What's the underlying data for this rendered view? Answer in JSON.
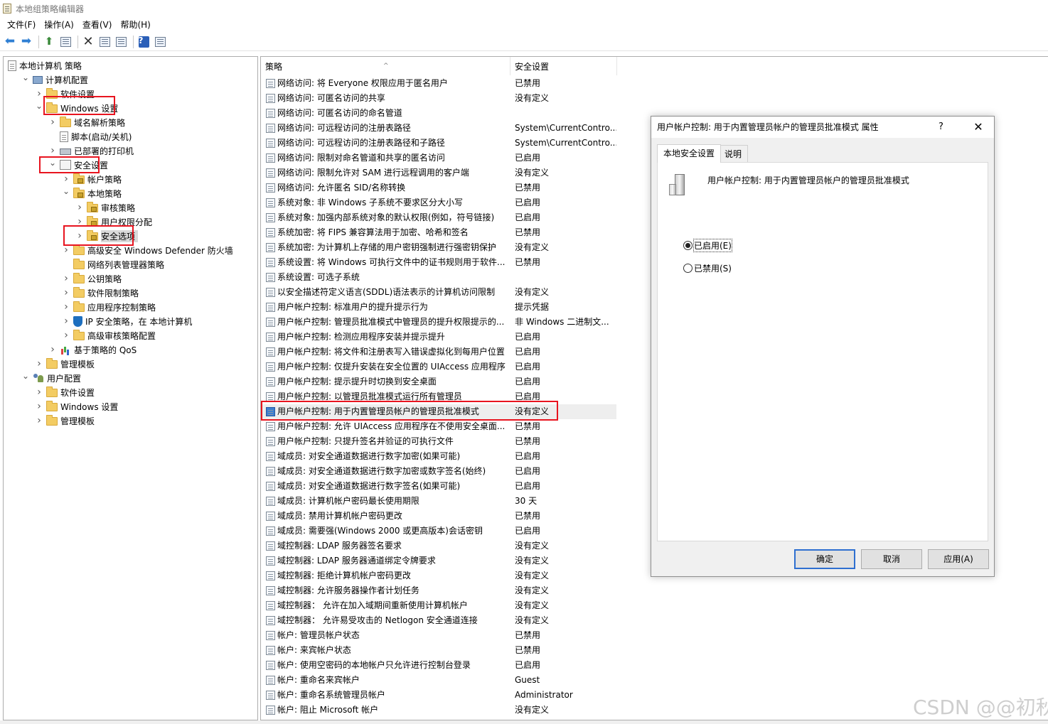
{
  "window": {
    "title": "本地组策略编辑器"
  },
  "menu": [
    "文件(F)",
    "操作(A)",
    "查看(V)",
    "帮助(H)"
  ],
  "toolbar_icons": [
    "back-arrow-icon",
    "forward-arrow-icon",
    "up-folder-icon",
    "show-hide-tree-icon",
    "delete-icon",
    "properties-icon",
    "export-list-icon",
    "help-icon",
    "view-icon"
  ],
  "tree": [
    {
      "label": "本地计算机 策略",
      "level": 0,
      "icon": "policy-doc-icon",
      "expander": ""
    },
    {
      "label": "计算机配置",
      "level": 1,
      "icon": "computer-icon",
      "expander": "open"
    },
    {
      "label": "软件设置",
      "level": 2,
      "icon": "folder-icon",
      "expander": "closed"
    },
    {
      "label": "Windows 设置",
      "level": 2,
      "icon": "folder-icon",
      "expander": "open"
    },
    {
      "label": "域名解析策略",
      "level": 3,
      "icon": "folder-icon",
      "expander": "closed"
    },
    {
      "label": "脚本(启动/关机)",
      "level": 3,
      "icon": "script-doc-icon",
      "expander": ""
    },
    {
      "label": "已部署的打印机",
      "level": 3,
      "icon": "printer-icon",
      "expander": "closed"
    },
    {
      "label": "安全设置",
      "level": 3,
      "icon": "security-settings-icon",
      "expander": "open"
    },
    {
      "label": "帐户策略",
      "level": 4,
      "icon": "lock-folder-icon",
      "expander": "closed"
    },
    {
      "label": "本地策略",
      "level": 4,
      "icon": "lock-folder-icon",
      "expander": "open"
    },
    {
      "label": "审核策略",
      "level": 5,
      "icon": "lock-folder-icon",
      "expander": "closed"
    },
    {
      "label": "用户权限分配",
      "level": 5,
      "icon": "lock-folder-icon",
      "expander": "closed"
    },
    {
      "label": "安全选项",
      "level": 5,
      "icon": "lock-folder-icon",
      "expander": "closed",
      "selected": true
    },
    {
      "label": "高级安全 Windows Defender 防火墙",
      "level": 4,
      "icon": "folder-icon",
      "expander": "closed"
    },
    {
      "label": "网络列表管理器策略",
      "level": 4,
      "icon": "folder-icon",
      "expander": ""
    },
    {
      "label": "公钥策略",
      "level": 4,
      "icon": "folder-icon",
      "expander": "closed"
    },
    {
      "label": "软件限制策略",
      "level": 4,
      "icon": "folder-icon",
      "expander": "closed"
    },
    {
      "label": "应用程序控制策略",
      "level": 4,
      "icon": "folder-icon",
      "expander": "closed"
    },
    {
      "label": "IP 安全策略，在 本地计算机",
      "level": 4,
      "icon": "ip-security-shield-icon",
      "expander": "closed"
    },
    {
      "label": "高级审核策略配置",
      "level": 4,
      "icon": "folder-icon",
      "expander": "closed"
    },
    {
      "label": "基于策略的 QoS",
      "level": 3,
      "icon": "qos-chart-icon",
      "expander": "closed"
    },
    {
      "label": "管理模板",
      "level": 2,
      "icon": "folder-icon",
      "expander": "closed"
    },
    {
      "label": "用户配置",
      "level": 1,
      "icon": "users-icon",
      "expander": "open"
    },
    {
      "label": "软件设置",
      "level": 2,
      "icon": "folder-icon",
      "expander": "closed"
    },
    {
      "label": "Windows 设置",
      "level": 2,
      "icon": "folder-icon",
      "expander": "closed"
    },
    {
      "label": "管理模板",
      "level": 2,
      "icon": "folder-icon",
      "expander": "closed"
    }
  ],
  "list": {
    "columns": [
      "策略",
      "安全设置"
    ],
    "rows": [
      {
        "name": "网络访问: 将 Everyone 权限应用于匿名用户",
        "value": "已禁用"
      },
      {
        "name": "网络访问: 可匿名访问的共享",
        "value": "没有定义"
      },
      {
        "name": "网络访问: 可匿名访问的命名管道",
        "value": ""
      },
      {
        "name": "网络访问: 可远程访问的注册表路径",
        "value": "System\\CurrentContro..."
      },
      {
        "name": "网络访问: 可远程访问的注册表路径和子路径",
        "value": "System\\CurrentContro..."
      },
      {
        "name": "网络访问: 限制对命名管道和共享的匿名访问",
        "value": "已启用"
      },
      {
        "name": "网络访问: 限制允许对 SAM 进行远程调用的客户端",
        "value": "没有定义"
      },
      {
        "name": "网络访问: 允许匿名 SID/名称转换",
        "value": "已禁用"
      },
      {
        "name": "系统对象: 非 Windows 子系统不要求区分大小写",
        "value": "已启用"
      },
      {
        "name": "系统对象: 加强内部系统对象的默认权限(例如，符号链接)",
        "value": "已启用"
      },
      {
        "name": "系统加密: 将 FIPS 兼容算法用于加密、哈希和签名",
        "value": "已禁用"
      },
      {
        "name": "系统加密: 为计算机上存储的用户密钥强制进行强密钥保护",
        "value": "没有定义"
      },
      {
        "name": "系统设置: 将 Windows 可执行文件中的证书规则用于软件...",
        "value": "已禁用"
      },
      {
        "name": "系统设置: 可选子系统",
        "value": ""
      },
      {
        "name": "以安全描述符定义语言(SDDL)语法表示的计算机访问限制",
        "value": "没有定义"
      },
      {
        "name": "用户帐户控制: 标准用户的提升提示行为",
        "value": "提示凭据"
      },
      {
        "name": "用户帐户控制: 管理员批准模式中管理员的提升权限提示的...",
        "value": "非 Windows 二进制文..."
      },
      {
        "name": "用户帐户控制: 检测应用程序安装并提示提升",
        "value": "已启用"
      },
      {
        "name": "用户帐户控制: 将文件和注册表写入错误虚拟化到每用户位置",
        "value": "已启用"
      },
      {
        "name": "用户帐户控制: 仅提升安装在安全位置的 UIAccess 应用程序",
        "value": "已启用"
      },
      {
        "name": "用户帐户控制: 提示提升时切换到安全桌面",
        "value": "已启用"
      },
      {
        "name": "用户帐户控制: 以管理员批准模式运行所有管理员",
        "value": "已启用"
      },
      {
        "name": "用户帐户控制: 用于内置管理员帐户的管理员批准模式",
        "value": "没有定义",
        "selected": true
      },
      {
        "name": "用户帐户控制: 允许 UIAccess 应用程序在不使用安全桌面...",
        "value": "已禁用"
      },
      {
        "name": "用户帐户控制: 只提升签名并验证的可执行文件",
        "value": "已禁用"
      },
      {
        "name": "域成员: 对安全通道数据进行数字加密(如果可能)",
        "value": "已启用"
      },
      {
        "name": "域成员: 对安全通道数据进行数字加密或数字签名(始终)",
        "value": "已启用"
      },
      {
        "name": "域成员: 对安全通道数据进行数字签名(如果可能)",
        "value": "已启用"
      },
      {
        "name": "域成员: 计算机帐户密码最长使用期限",
        "value": "30 天"
      },
      {
        "name": "域成员: 禁用计算机帐户密码更改",
        "value": "已禁用"
      },
      {
        "name": "域成员: 需要强(Windows 2000 或更高版本)会话密钥",
        "value": "已启用"
      },
      {
        "name": "域控制器: LDAP 服务器签名要求",
        "value": "没有定义"
      },
      {
        "name": "域控制器: LDAP 服务器通道绑定令牌要求",
        "value": "没有定义"
      },
      {
        "name": "域控制器: 拒绝计算机帐户密码更改",
        "value": "没有定义"
      },
      {
        "name": "域控制器: 允许服务器操作者计划任务",
        "value": "没有定义"
      },
      {
        "name": "域控制器： 允许在加入域期间重新使用计算机帐户",
        "value": "没有定义"
      },
      {
        "name": "域控制器： 允许易受攻击的 Netlogon 安全通道连接",
        "value": "没有定义"
      },
      {
        "name": "帐户: 管理员帐户状态",
        "value": "已禁用"
      },
      {
        "name": "帐户: 来宾帐户状态",
        "value": "已禁用"
      },
      {
        "name": "帐户: 使用空密码的本地帐户只允许进行控制台登录",
        "value": "已启用"
      },
      {
        "name": "帐户: 重命名来宾帐户",
        "value": "Guest"
      },
      {
        "name": "帐户: 重命名系统管理员帐户",
        "value": "Administrator"
      },
      {
        "name": "帐户: 阻止 Microsoft 帐户",
        "value": "没有定义"
      }
    ]
  },
  "dialog": {
    "title": "用户帐户控制: 用于内置管理员帐户的管理员批准模式 属性",
    "help": "?",
    "close": "✕",
    "tabs": [
      "本地安全设置",
      "说明"
    ],
    "heading": "用户帐户控制: 用于内置管理员帐户的管理员批准模式",
    "options": [
      {
        "label": "已启用(E)",
        "checked": true
      },
      {
        "label": "已禁用(S)",
        "checked": false
      }
    ],
    "buttons": {
      "ok": "确定",
      "cancel": "取消",
      "apply": "应用(A)"
    }
  },
  "watermark": "CSDN @@初秋"
}
